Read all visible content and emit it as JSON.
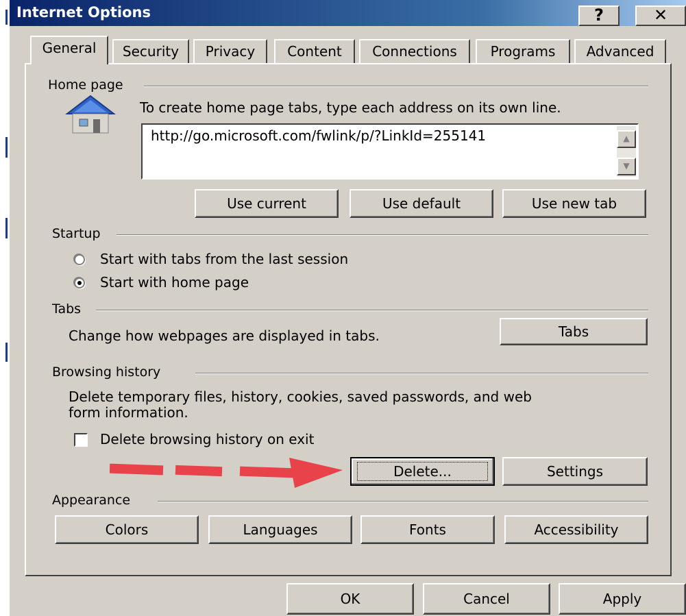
{
  "window": {
    "title": "Internet Options",
    "help_label": "?",
    "close_label": "✕"
  },
  "tabs": [
    {
      "label": "General",
      "active": true
    },
    {
      "label": "Security"
    },
    {
      "label": "Privacy"
    },
    {
      "label": "Content"
    },
    {
      "label": "Connections"
    },
    {
      "label": "Programs"
    },
    {
      "label": "Advanced"
    }
  ],
  "home_page": {
    "group_label": "Home page",
    "instruction": "To create home page tabs, type each address on its own line.",
    "url_value": "http://go.microsoft.com/fwlink/p/?LinkId=255141",
    "icon": "house-icon",
    "buttons": {
      "use_current": "Use current",
      "use_default": "Use default",
      "use_new_tab": "Use new tab"
    }
  },
  "startup": {
    "group_label": "Startup",
    "option_last_session": "Start with tabs from the last session",
    "option_home_page": "Start with home page",
    "selected": "home_page"
  },
  "tabs_group": {
    "group_label": "Tabs",
    "description": "Change how webpages are displayed in tabs.",
    "button": "Tabs"
  },
  "browsing_history": {
    "group_label": "Browsing history",
    "description_line1": "Delete temporary files, history, cookies, saved passwords, and web",
    "description_line2": "form information.",
    "checkbox_label": "Delete browsing history on exit",
    "checkbox_checked": false,
    "delete_button": "Delete...",
    "settings_button": "Settings"
  },
  "appearance": {
    "group_label": "Appearance",
    "colors": "Colors",
    "languages": "Languages",
    "fonts": "Fonts",
    "accessibility": "Accessibility"
  },
  "footer": {
    "ok": "OK",
    "cancel": "Cancel",
    "apply": "Apply"
  },
  "colors": {
    "dialog_bg": "#d4d0c8",
    "titlebar_start": "#0a246a",
    "annotation_arrow": "#e8424a"
  }
}
